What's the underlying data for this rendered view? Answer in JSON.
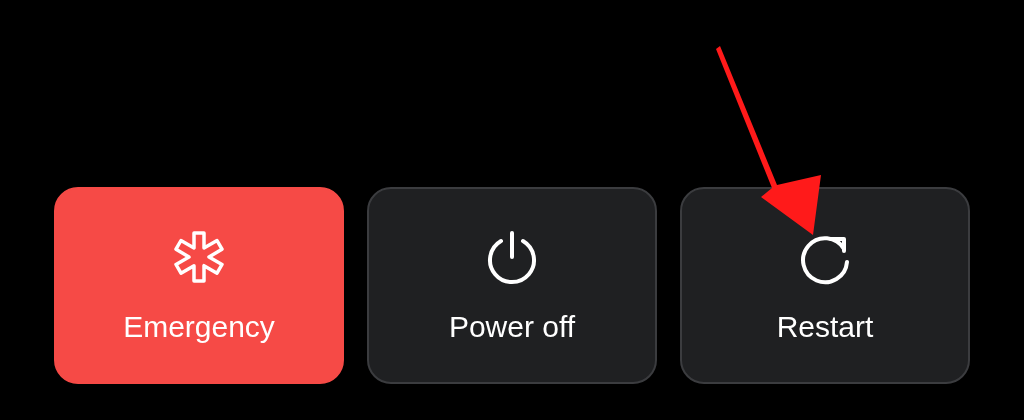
{
  "buttons": [
    {
      "kind": "emergency",
      "label": "Emergency",
      "highlighted": false
    },
    {
      "kind": "power",
      "label": "Power off",
      "highlighted": false
    },
    {
      "kind": "restart",
      "label": "Restart",
      "highlighted": true
    }
  ]
}
